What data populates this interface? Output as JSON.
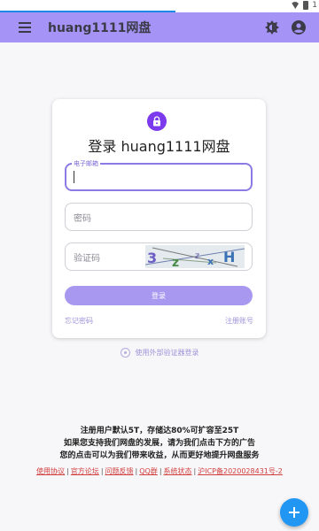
{
  "status_bar": {
    "time": "1"
  },
  "app_bar": {
    "title": "huang1111网盘",
    "menu_icon": "menu-icon",
    "theme_icon": "brightness-icon",
    "account_icon": "account-circle-icon"
  },
  "login_card": {
    "lock_icon": "lock-icon",
    "title": "登录 huang1111网盘",
    "email_label": "电子邮箱",
    "email_value": "",
    "password_placeholder": "密码",
    "captcha_placeholder": "验证码",
    "captcha_image": "captcha-image",
    "login_button": "登录",
    "forgot_password": "忘记密码",
    "register": "注册账号"
  },
  "external_login": {
    "icon": "fingerprint-icon",
    "label": "使用外部验证器登录"
  },
  "notice": {
    "line1": "注册用户默认5T，存储达80%可扩容至25T",
    "line2": "如果您支持我们网盘的发展，请为我们点击下方的广告",
    "line3": "您的点击可以为我们带来收益，从而更好地提升网盘服务"
  },
  "footer": {
    "links": [
      "使用协议",
      "官方论坛",
      "问题反馈",
      "QQ群",
      "系统状态",
      "沪ICP备2020028431号-2"
    ],
    "separator": "|"
  },
  "fab": {
    "icon": "add-icon"
  },
  "colors": {
    "app_bar": "#a593f5",
    "accent": "#7c3aed",
    "button": "#a898ef",
    "link": "#9e93d9",
    "footer_link": "#d23d3d",
    "fab": "#2196f3"
  }
}
